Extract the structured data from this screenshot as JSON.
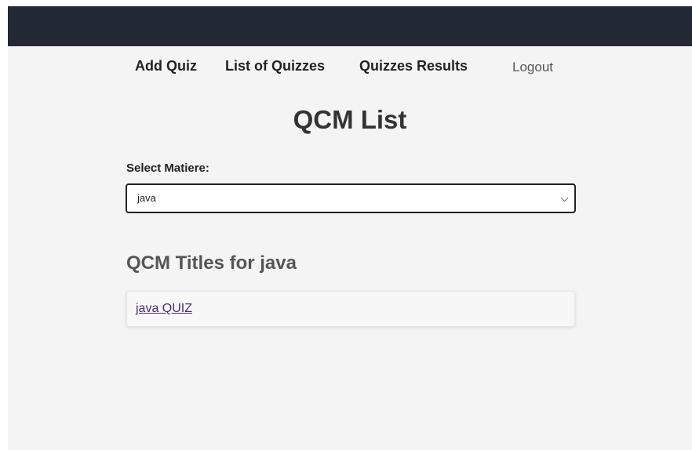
{
  "nav": {
    "items": [
      {
        "label": "Add Quiz"
      },
      {
        "label": "List of Quizzes"
      },
      {
        "label": "Quizzes Results"
      }
    ],
    "logout_label": "Logout"
  },
  "page": {
    "title": "QCM List",
    "select_label": "Select Matiere:",
    "selected_matiere": "java",
    "section_title": "QCM Titles for java",
    "quizzes": [
      {
        "title": "java QUIZ"
      }
    ]
  },
  "colors": {
    "topbar": "#222834",
    "background": "#f4f4f4",
    "link_visited": "#4b2d6e"
  },
  "icons": {
    "select_chevron": "chevron-down-icon"
  }
}
